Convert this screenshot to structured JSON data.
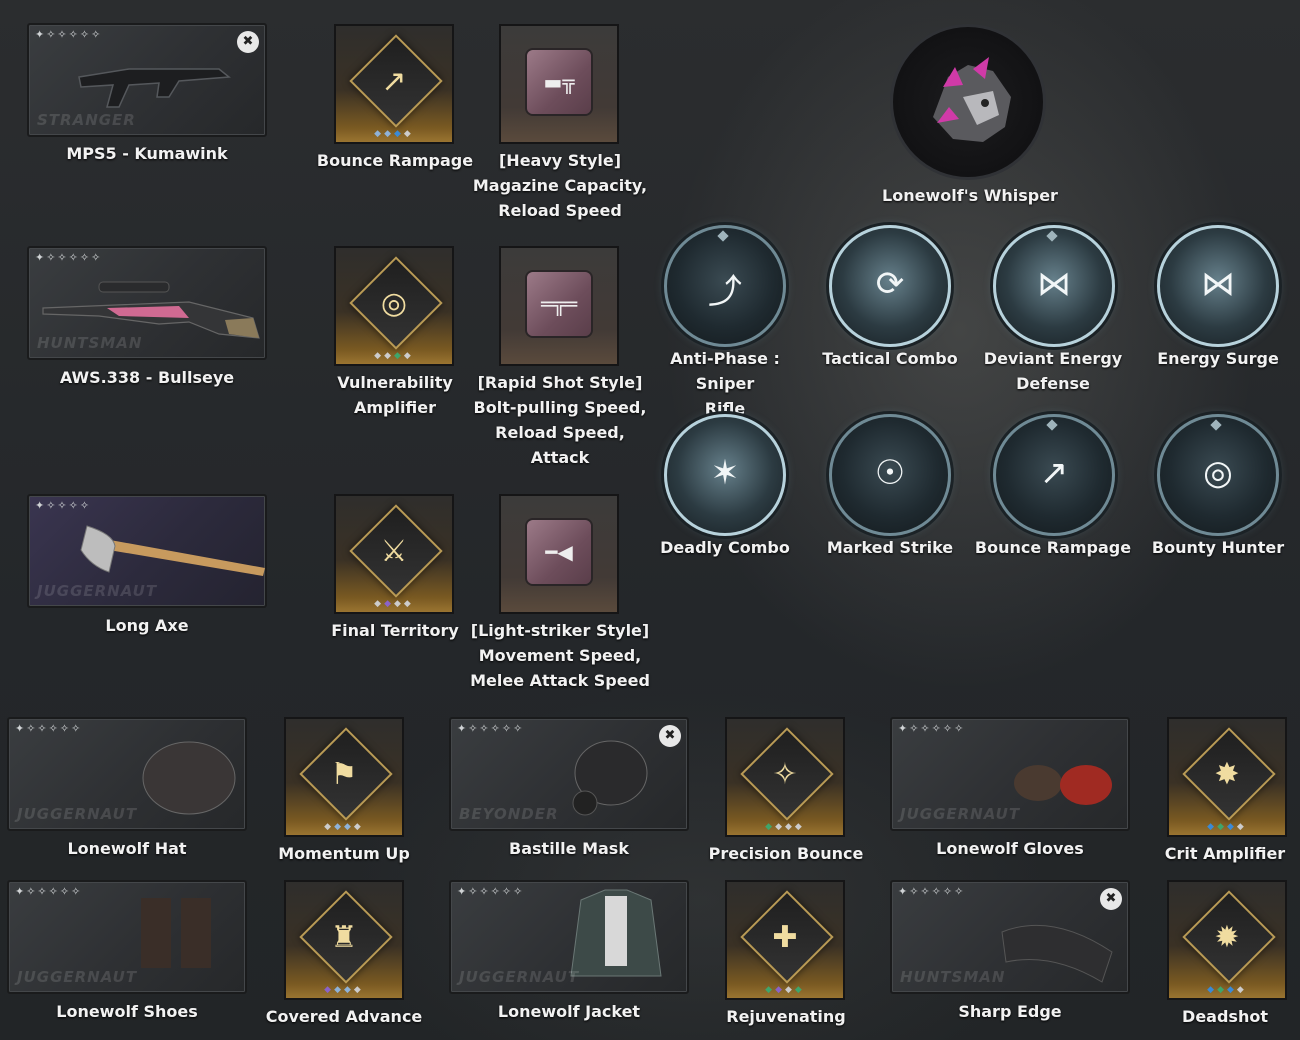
{
  "weapons": [
    {
      "name": "MPS5 - Kumawink",
      "brand": "STRANGER",
      "stars": "✦✧✧✧✧✧",
      "removable": true
    },
    {
      "name": "AWS.338 - Bullseye",
      "brand": "HUNTSMAN",
      "stars": "✦✧✧✧✧✧",
      "removable": false
    },
    {
      "name": "Long Axe",
      "brand": "JUGGERNAUT",
      "stars": "✦✧✧✧✧",
      "removable": false
    }
  ],
  "modules_left": [
    {
      "name": "Bounce Rampage",
      "icon": "bounce-icon"
    },
    {
      "name": "Vulnerability\nAmplifier",
      "icon": "target-icon"
    },
    {
      "name": "Final Territory",
      "icon": "territory-icon"
    }
  ],
  "style_mods": [
    {
      "name": "[Heavy Style]\nMagazine Capacity,\nReload Speed",
      "icon": "smg-icon"
    },
    {
      "name": "[Rapid Shot Style]\nBolt-pulling Speed,\nReload Speed,\nAttack",
      "icon": "rifle-icon"
    },
    {
      "name": "[Light-striker Style]\nMovement Speed,\nMelee Attack Speed",
      "icon": "knife-icon"
    }
  ],
  "whisper": {
    "name": "Lonewolf's Whisper"
  },
  "skills": [
    {
      "name": "Anti-Phase : Sniper\nRifle",
      "icon": "sniper-up-icon"
    },
    {
      "name": "Tactical Combo",
      "icon": "combo-icon"
    },
    {
      "name": "Deviant Energy\nDefense",
      "icon": "butterfly-shield-icon"
    },
    {
      "name": "Energy Surge",
      "icon": "butterfly-icon"
    },
    {
      "name": "Deadly Combo",
      "icon": "deadly-combo-icon"
    },
    {
      "name": "Marked Strike",
      "icon": "marked-icon"
    },
    {
      "name": "Bounce Rampage",
      "icon": "bounce-icon"
    },
    {
      "name": "Bounty Hunter",
      "icon": "bounty-icon"
    }
  ],
  "gear": [
    {
      "name": "Lonewolf Hat",
      "brand": "JUGGERNAUT",
      "stars": "✦✧✧✧✧✧"
    },
    {
      "name": "Bastille Mask",
      "brand": "BEYONDER",
      "stars": "✦✧✧✧✧✧",
      "removable": true
    },
    {
      "name": "Lonewolf Gloves",
      "brand": "JUGGERNAUT",
      "stars": "✦✧✧✧✧✧"
    },
    {
      "name": "Lonewolf Shoes",
      "brand": "JUGGERNAUT",
      "stars": "✦✧✧✧✧✧"
    },
    {
      "name": "Lonewolf Jacket",
      "brand": "JUGGERNAUT",
      "stars": "✦✧✧✧✧✧"
    },
    {
      "name": "Sharp Edge",
      "brand": "HUNTSMAN",
      "stars": "✦✧✧✧✧✧",
      "removable": true
    }
  ],
  "gear_mods": [
    {
      "name": "Momentum Up",
      "icon": "momentum-icon"
    },
    {
      "name": "Precision Bounce",
      "icon": "precision-icon"
    },
    {
      "name": "Crit Amplifier",
      "icon": "crit-icon"
    },
    {
      "name": "Covered Advance",
      "icon": "covered-icon"
    },
    {
      "name": "Rejuvenating",
      "icon": "rejuv-icon"
    },
    {
      "name": "Deadshot",
      "icon": "deadshot-icon"
    }
  ],
  "glyphs": {
    "close": "✖",
    "dots": "◆◆◆◆"
  }
}
